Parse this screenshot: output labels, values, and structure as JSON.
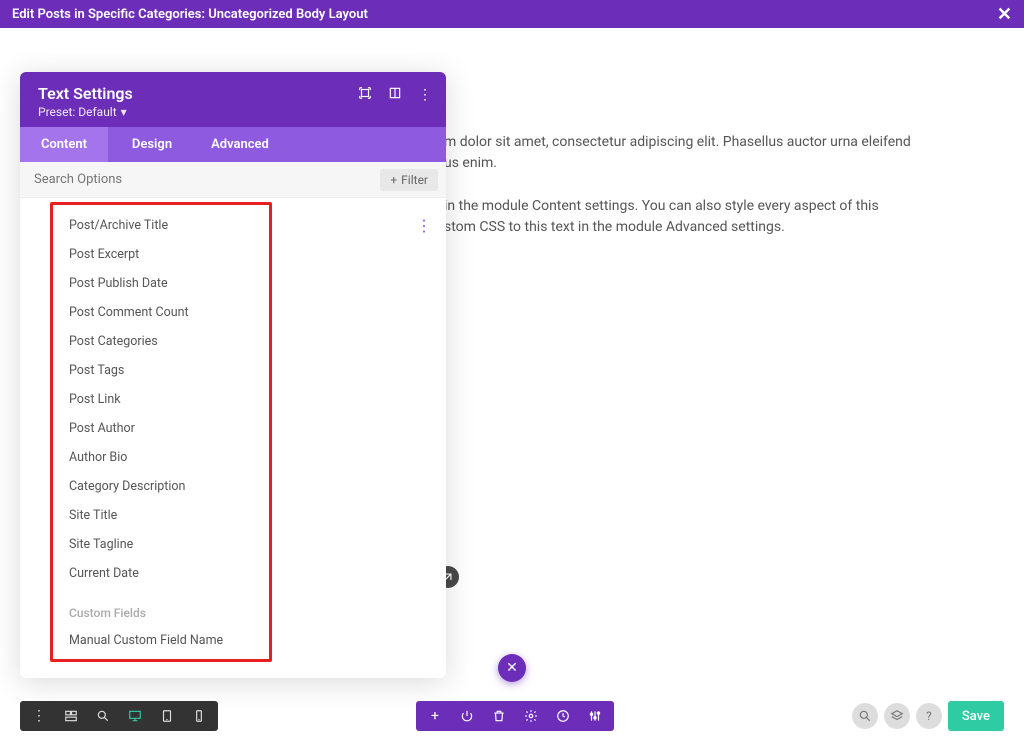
{
  "topbar": {
    "title": "Edit Posts in Specific Categories: Uncategorized Body Layout"
  },
  "page_content": {
    "para1": "m dolor sit amet, consectetur adipiscing elit. Phasellus auctor urna eleifend",
    "para1b": "us enim.",
    "para2": "in the module Content settings. You can also style every aspect of this",
    "para2b": "stom CSS to this text in the module Advanced settings."
  },
  "panel": {
    "title": "Text Settings",
    "preset_label": "Preset: Default",
    "tabs": {
      "content": "Content",
      "design": "Design",
      "advanced": "Advanced"
    },
    "search_placeholder": "Search Options",
    "filter_label": "Filter"
  },
  "dropdown": {
    "items": [
      "Post/Archive Title",
      "Post Excerpt",
      "Post Publish Date",
      "Post Comment Count",
      "Post Categories",
      "Post Tags",
      "Post Link",
      "Post Author",
      "Author Bio",
      "Category Description",
      "Site Title",
      "Site Tagline",
      "Current Date"
    ],
    "section_label": "Custom Fields",
    "custom_item": "Manual Custom Field Name"
  },
  "bottom": {
    "save": "Save"
  }
}
